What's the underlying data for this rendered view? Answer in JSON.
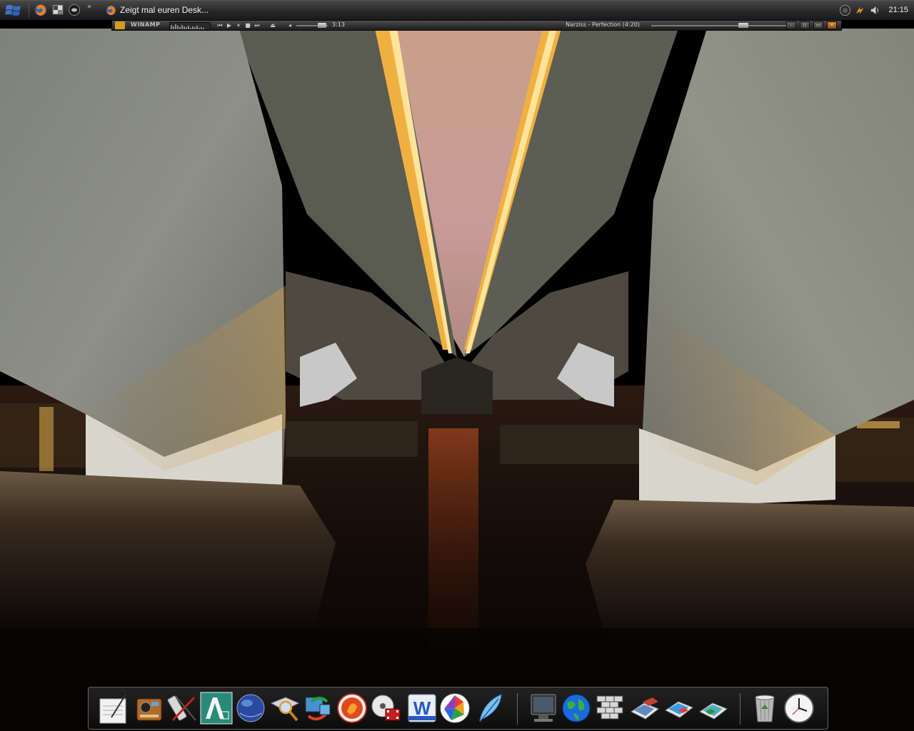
{
  "taskbar": {
    "start_icon": "windows-start-icon",
    "quick_launch": [
      {
        "name": "firefox-icon"
      },
      {
        "name": "show-desktop-icon"
      },
      {
        "name": "media-icon"
      }
    ],
    "quick_launch_more": "»",
    "task_button": {
      "icon": "firefox-icon",
      "label": "Zeigt mal euren Desk..."
    },
    "tray_icons": [
      "network-icon",
      "power-icon",
      "speaker-icon"
    ],
    "clock": "21:15"
  },
  "winamp": {
    "title": "WINAMP",
    "time": "3:13",
    "song": "Narziss - Perfection (4:20)",
    "controls": [
      "previous",
      "play",
      "pause",
      "stop",
      "next",
      "eject"
    ],
    "colors": {
      "logo": "#d49a2a"
    }
  },
  "dock": {
    "items": [
      {
        "name": "textedit-icon"
      },
      {
        "name": "media-player-icon"
      },
      {
        "name": "graphics-tool-icon"
      },
      {
        "name": "autocad-icon"
      },
      {
        "name": "globe-browser-icon"
      },
      {
        "name": "image-viewer-icon"
      },
      {
        "name": "sync-icon"
      },
      {
        "name": "firefox-orange-icon"
      },
      {
        "name": "dvd-video-icon"
      },
      {
        "name": "word-icon"
      },
      {
        "name": "picasa-icon"
      },
      {
        "name": "feather-icon"
      },
      {
        "name": "my-computer-icon"
      },
      {
        "name": "network-globe-icon"
      },
      {
        "name": "firewall-icon"
      },
      {
        "name": "photos-icon-1"
      },
      {
        "name": "photos-icon-2"
      },
      {
        "name": "photos-icon-3"
      },
      {
        "name": "recycle-bin-icon"
      },
      {
        "name": "clock-icon"
      }
    ]
  }
}
